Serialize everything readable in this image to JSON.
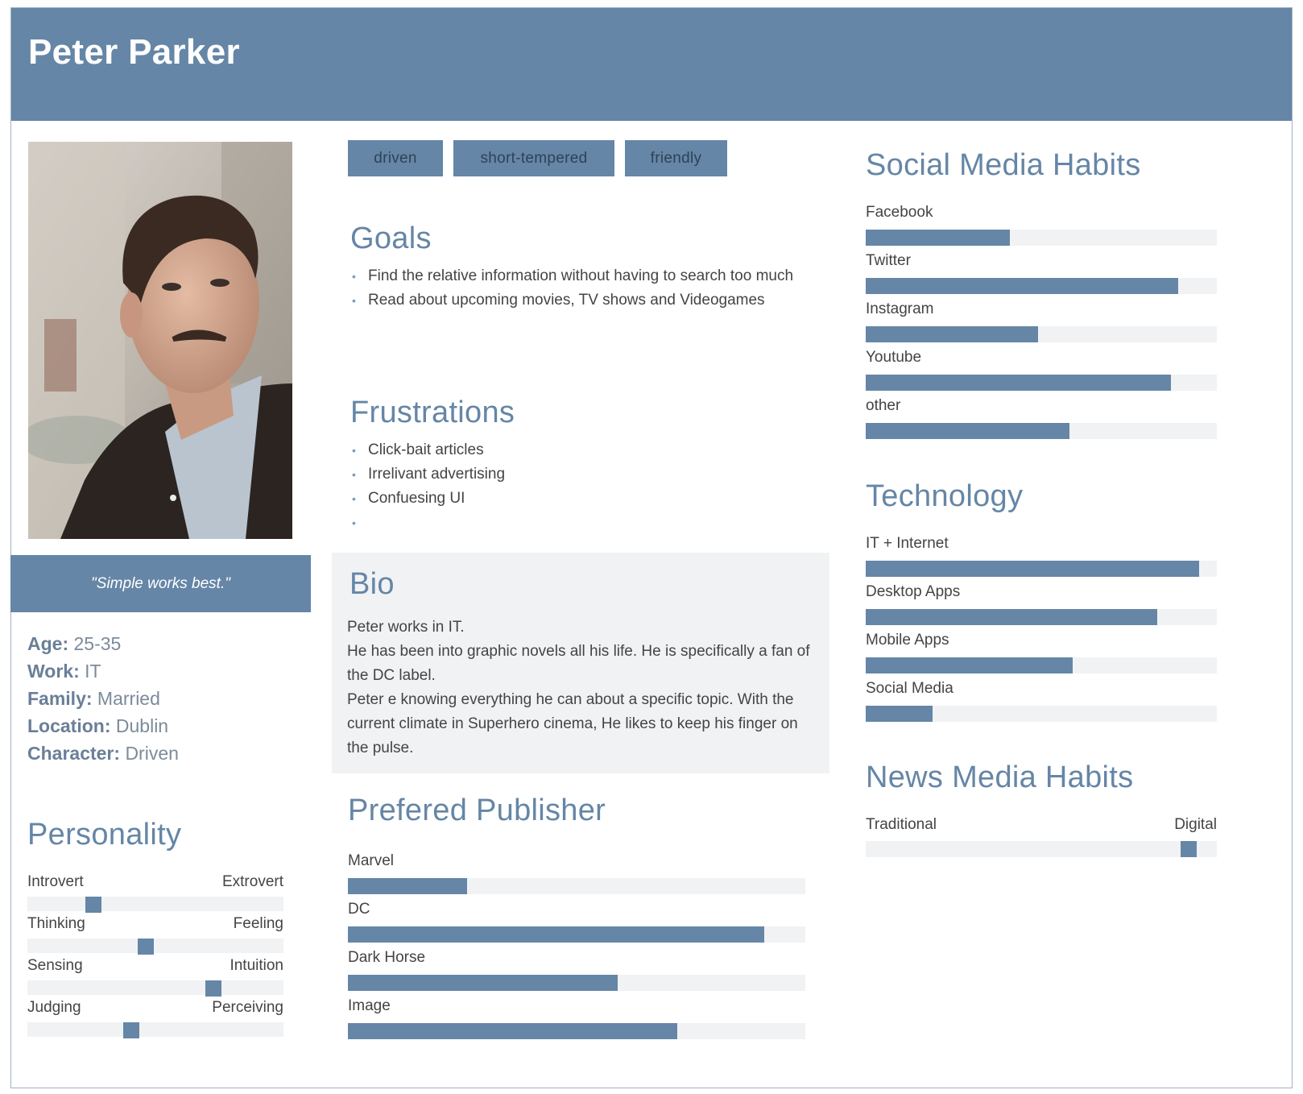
{
  "persona": {
    "name": "Peter Parker",
    "quote": "\"Simple works best.\"",
    "photo_alt": "portrait photo"
  },
  "facts": [
    {
      "key": "Age:",
      "value": "25-35"
    },
    {
      "key": "Work:",
      "value": "IT"
    },
    {
      "key": "Family:",
      "value": "Married"
    },
    {
      "key": "Location:",
      "value": "Dublin"
    },
    {
      "key": "Character:",
      "value": "Driven"
    }
  ],
  "personality": {
    "title": "Personality",
    "traits": [
      {
        "left": "Introvert",
        "right": "Extrovert",
        "level": 0.24
      },
      {
        "left": "Thinking",
        "right": "Feeling",
        "level": 0.46
      },
      {
        "left": "Sensing",
        "right": "Intuition",
        "level": 0.74
      },
      {
        "left": "Judging",
        "right": "Perceiving",
        "level": 0.4
      }
    ]
  },
  "tags": [
    "driven",
    "short-tempered",
    "friendly"
  ],
  "goals": {
    "title": "Goals",
    "items": [
      "Find the relative information without having to search too much",
      "Read about upcoming movies, TV shows and Videogames"
    ]
  },
  "frustrations": {
    "title": "Frustrations",
    "items": [
      "Click-bait articles",
      "Irrelivant advertising",
      "Confuesing UI",
      ""
    ]
  },
  "bio": {
    "title": "Bio",
    "lines": [
      "Peter works in IT.",
      "He has been into graphic novels all his life. He is specifically a fan of the DC label.",
      "Peter e knowing everything he can about a specific topic. With the current climate in Superhero cinema, He likes to keep his finger on the pulse."
    ]
  },
  "publisher": {
    "title": "Prefered Publisher",
    "items": [
      {
        "label": "Marvel",
        "value": 0.26
      },
      {
        "label": "DC",
        "value": 0.91
      },
      {
        "label": "Dark Horse",
        "value": 0.59
      },
      {
        "label": "Image",
        "value": 0.72
      }
    ]
  },
  "social_media": {
    "title": "Social Media Habits",
    "items": [
      {
        "label": "Facebook",
        "value": 0.41
      },
      {
        "label": "Twitter",
        "value": 0.89
      },
      {
        "label": "Instagram",
        "value": 0.49
      },
      {
        "label": "Youtube",
        "value": 0.87
      },
      {
        "label": "other",
        "value": 0.58
      }
    ]
  },
  "technology": {
    "title": "Technology",
    "items": [
      {
        "label": "IT + Internet",
        "value": 0.95
      },
      {
        "label": "Desktop Apps",
        "value": 0.83
      },
      {
        "label": "Mobile Apps",
        "value": 0.59
      },
      {
        "label": "Social Media",
        "value": 0.19
      }
    ]
  },
  "news_media": {
    "title": "News Media Habits",
    "left": "Traditional",
    "right": "Digital",
    "level": 0.94
  },
  "colors": {
    "accent": "#6586a6",
    "track": "#f1f2f4"
  }
}
